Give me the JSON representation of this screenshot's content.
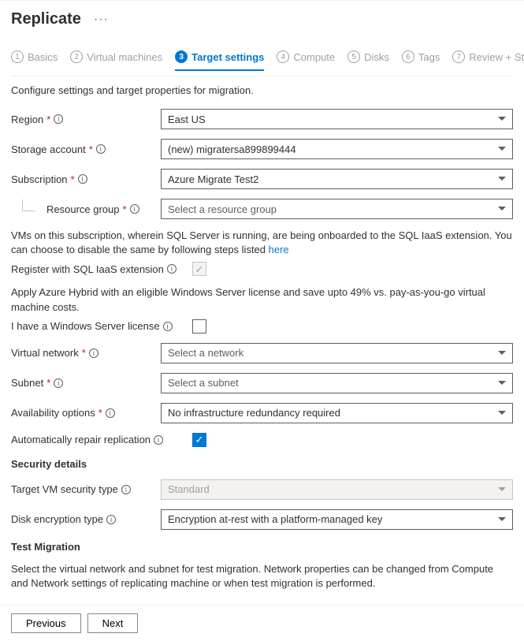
{
  "header": {
    "title": "Replicate"
  },
  "steps": [
    {
      "num": "1",
      "label": "Basics"
    },
    {
      "num": "2",
      "label": "Virtual machines"
    },
    {
      "num": "3",
      "label": "Target settings"
    },
    {
      "num": "4",
      "label": "Compute"
    },
    {
      "num": "5",
      "label": "Disks"
    },
    {
      "num": "6",
      "label": "Tags"
    },
    {
      "num": "7",
      "label": "Review + Start replication"
    }
  ],
  "intro": "Configure settings and target properties for migration.",
  "labels": {
    "region": "Region",
    "storage": "Storage account",
    "subscription": "Subscription",
    "resourceGroup": "Resource group",
    "registerIaas": "Register with SQL IaaS extension",
    "winLicense": "I have a Windows Server license",
    "vnet": "Virtual network",
    "subnet": "Subnet",
    "availability": "Availability options",
    "autoRepair": "Automatically repair replication",
    "targetVmSec": "Target VM security type",
    "diskEnc": "Disk encryption type"
  },
  "values": {
    "region": "East US",
    "storage": "(new) migratersa899899444",
    "subscription": "Azure Migrate Test2",
    "resourceGroup": "Select a resource group",
    "vnet": "Select a network",
    "subnet": "Select a subnet",
    "availability": "No infrastructure redundancy required",
    "targetVmSec": "Standard",
    "diskEnc": "Encryption at-rest with a platform-managed key"
  },
  "notes": {
    "sql": "VMs on this subscription, wherein SQL Server is running, are being onboarded to the SQL IaaS extension. You can choose to disable the same by following steps listed ",
    "sqlLink": "here",
    "hybrid": "Apply Azure Hybrid with an eligible Windows Server license and save upto 49% vs. pay-as-you-go virtual machine costs.",
    "testMigration": "Select the virtual network and subnet for test migration. Network properties can be changed from Compute and Network settings of replicating machine or when test migration is performed."
  },
  "sections": {
    "security": "Security details",
    "testMigration": "Test Migration"
  },
  "footer": {
    "previous": "Previous",
    "next": "Next"
  }
}
